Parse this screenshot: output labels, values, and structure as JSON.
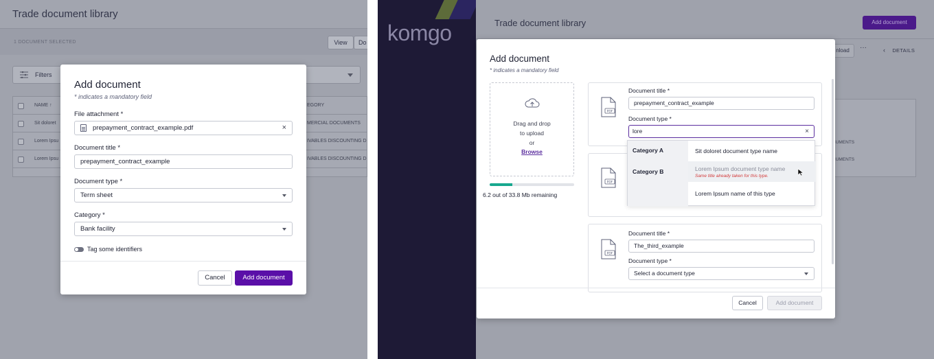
{
  "left": {
    "bg": {
      "title": "Trade document library",
      "selected": "1 DOCUMENT SELECTED",
      "view_label": "View",
      "do_label": "Do",
      "filters_label": "Filters",
      "col_name": "NAME ↑",
      "col_category": "EGORY",
      "rows": [
        {
          "name": "Sit doloret",
          "category": "MERCIAL DOCUMENTS"
        },
        {
          "name": "Lorem Ipsu",
          "category": "IVABLES DISCOUNTING D"
        },
        {
          "name": "Lorem Ipsu",
          "category": "IVABLES DISCOUNTING D"
        }
      ]
    },
    "modal": {
      "title": "Add document",
      "note": "* indicates a mandatory field",
      "file_label": "File attachment *",
      "file_value": "prepayment_contract_example.pdf",
      "doc_title_label": "Document title *",
      "doc_title_value": "prepayment_contract_example",
      "doc_type_label": "Document type *",
      "doc_type_value": "Term sheet",
      "category_label": "Category *",
      "category_value": "Bank facility",
      "toggle_label": "Tag some identifiers",
      "cancel": "Cancel",
      "add": "Add document"
    }
  },
  "right": {
    "brand": "komgo",
    "bg": {
      "title": "Trade document library",
      "add_button": "Add document",
      "download": "nload",
      "more": "···",
      "details": "DETAILS",
      "rows": [
        "CUMENTS",
        "CUMENTS"
      ]
    },
    "modal": {
      "title": "Add document",
      "note": "* indicates a mandatory field",
      "drop_text_1": "Drag and drop",
      "drop_text_2": "to upload",
      "drop_text_3": "or",
      "browse": "Browse",
      "progress_fraction": 0.27,
      "progress_text": "6.2 out of 33.8 Mb remaining",
      "cards": [
        {
          "title_label": "Document title *",
          "title_value": "prepayment_contract_example",
          "type_label": "Document type *",
          "type_value": "lore"
        },
        {
          "title_label": "Document title *",
          "title_value": "The_third_example",
          "type_label": "Document type *",
          "type_value": "Select a document type"
        }
      ],
      "dropdown": {
        "category_a": "Category A",
        "category_b": "Category B",
        "option_1": "Sit doloret document type name",
        "option_2": "Lorem Ipsum document type name",
        "option_2_warning": "Same title already taken for this type.",
        "option_3": "Lorem Ipsum name of this type"
      },
      "cancel": "Cancel",
      "add": "Add document"
    }
  },
  "colors": {
    "primary": "#5a0fa8",
    "sidebar": "#1e1a36",
    "progress": "#18a88f",
    "warning": "#d23a3a"
  }
}
